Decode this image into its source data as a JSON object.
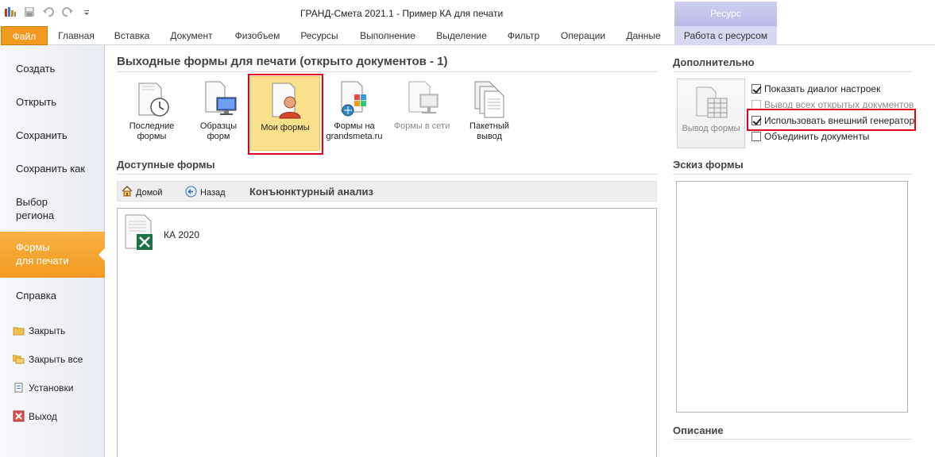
{
  "window": {
    "title": "ГРАНД-Смета 2021.1 - Пример КА для печати",
    "context_group": "Ресурс"
  },
  "tabs": [
    {
      "label": "Файл",
      "active": true
    },
    {
      "label": "Главная"
    },
    {
      "label": "Вставка"
    },
    {
      "label": "Документ"
    },
    {
      "label": "Физобъем"
    },
    {
      "label": "Ресурсы"
    },
    {
      "label": "Выполнение"
    },
    {
      "label": "Выделение"
    },
    {
      "label": "Фильтр"
    },
    {
      "label": "Операции"
    },
    {
      "label": "Данные"
    },
    {
      "label": "Работа с ресурсом",
      "contextual": true
    }
  ],
  "left_menu": {
    "items": [
      {
        "label": "Создать"
      },
      {
        "label": "Открыть"
      },
      {
        "label": "Сохранить"
      },
      {
        "label": "Сохранить как"
      },
      {
        "label_line1": "Выбор",
        "label_line2": "региона"
      },
      {
        "label_line1": "Формы",
        "label_line2": "для печати",
        "active": true
      },
      {
        "label": "Справка"
      }
    ],
    "small_items": [
      {
        "label": "Закрыть",
        "icon": "folder-close-icon"
      },
      {
        "label": "Закрыть все",
        "icon": "folders-close-icon"
      },
      {
        "label": "Установки",
        "icon": "settings-icon"
      },
      {
        "label": "Выход",
        "icon": "exit-icon"
      }
    ]
  },
  "main": {
    "title": "Выходные формы для печати (открыто документов - 1)",
    "form_sources": [
      {
        "line1": "Последние",
        "line2": "формы",
        "icon": "recent-forms-icon"
      },
      {
        "line1": "Образцы",
        "line2": "форм",
        "icon": "form-samples-icon"
      },
      {
        "line1": "Мои формы",
        "line2": "",
        "icon": "my-forms-icon",
        "selected": true
      },
      {
        "line1": "Формы на",
        "line2": "grandsmeta.ru",
        "icon": "web-forms-icon"
      },
      {
        "line1": "Формы в сети",
        "line2": "",
        "icon": "network-forms-icon",
        "disabled": true
      },
      {
        "line1": "Пакетный",
        "line2": "вывод",
        "icon": "batch-output-icon"
      }
    ],
    "available_title": "Доступные формы",
    "nav": {
      "home_label": "Домой",
      "back_label": "Назад",
      "current_folder": "Конъюнктурный анализ"
    },
    "files": [
      {
        "name": "КА 2020",
        "icon": "excel-form-icon"
      }
    ]
  },
  "right": {
    "extra_title": "Дополнительно",
    "output_button_label": "Вывод формы",
    "options": [
      {
        "label": "Показать диалог настроек",
        "checked": true,
        "enabled": true
      },
      {
        "label": "Вывод всех открытых документов",
        "checked": false,
        "enabled": false
      },
      {
        "label": "Использовать внешний генератор",
        "checked": true,
        "enabled": true,
        "highlighted": true
      },
      {
        "label": "Объединить документы",
        "checked": false,
        "enabled": true
      }
    ],
    "sketch_title": "Эскиз формы",
    "description_title": "Описание"
  },
  "colors": {
    "accent_orange": "#f29a1f",
    "selected_bg": "#fbe08c",
    "highlight_red": "#e0001b",
    "context_tab": "#d6d9f2"
  }
}
